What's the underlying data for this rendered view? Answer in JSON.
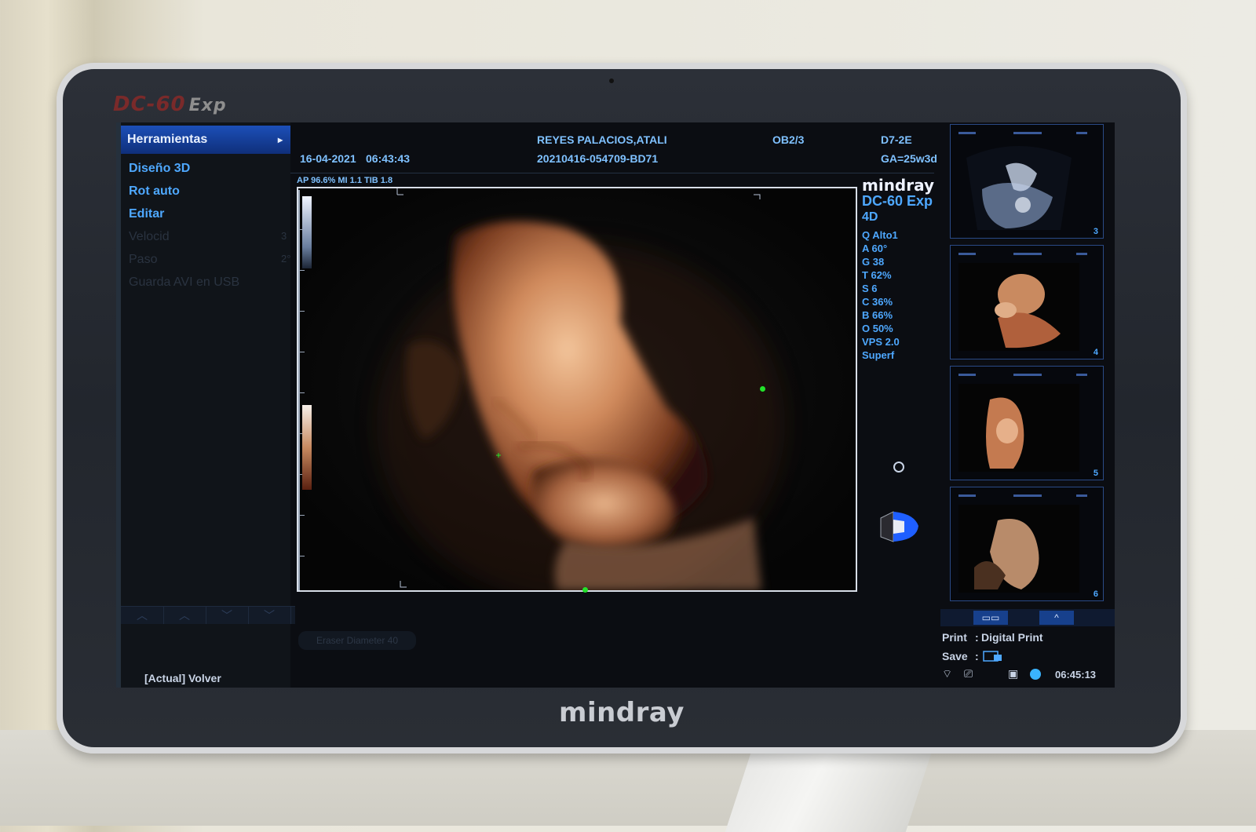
{
  "device": {
    "brand_top": "DC-60",
    "brand_top_suffix": "Exp",
    "brand_bottom": "mindray"
  },
  "sidebar": {
    "header": "Herramientas",
    "header_arrow": "▸",
    "items": [
      {
        "label": "Diseño 3D",
        "enabled": true
      },
      {
        "label": "Rot auto",
        "enabled": true
      },
      {
        "label": "Editar",
        "enabled": true
      },
      {
        "label": "Velocid",
        "value": "3",
        "enabled": false
      },
      {
        "label": "Paso",
        "value": "2°",
        "enabled": false
      },
      {
        "label": "Guarda AVI en USB",
        "enabled": false
      }
    ],
    "back_label": "[Actual] Volver"
  },
  "header": {
    "date": "16-04-2021",
    "time": "06:43:43",
    "patient_name": "REYES PALACIOS,ATALI",
    "exam_id": "20210416-054709-BD71",
    "exam_type": "OB2/3",
    "probe": "D7-2E",
    "gestational_age": "GA=25w3d",
    "acoustic": "AP 96.6%  MI 1.1  TIB 1.8"
  },
  "params": {
    "logo": "mindray",
    "model": "DC-60 Exp",
    "mode": "4D",
    "values": [
      "Q Alto1",
      "A 60°",
      "G 38",
      "T 62%",
      "S 6",
      "C 36%",
      "B 66%",
      "O 50%",
      "VPS 2.0",
      "Superf"
    ]
  },
  "thumbnails": [
    {
      "number": "3"
    },
    {
      "number": "4"
    },
    {
      "number": "5"
    },
    {
      "number": "6"
    }
  ],
  "thumb_nav": {
    "layout_btn": "▭▭",
    "up_btn": "^"
  },
  "footer": {
    "print_label": "Print",
    "print_value": "Digital Print",
    "save_label": "Save",
    "colon": ":",
    "clock": "06:45:13",
    "eraser": "Eraser Diameter   40"
  },
  "colors": {
    "accent": "#4ea8ff",
    "menu_header": "#1c4fb8",
    "skin": "#d08a5c",
    "background": "#0b0d12"
  }
}
